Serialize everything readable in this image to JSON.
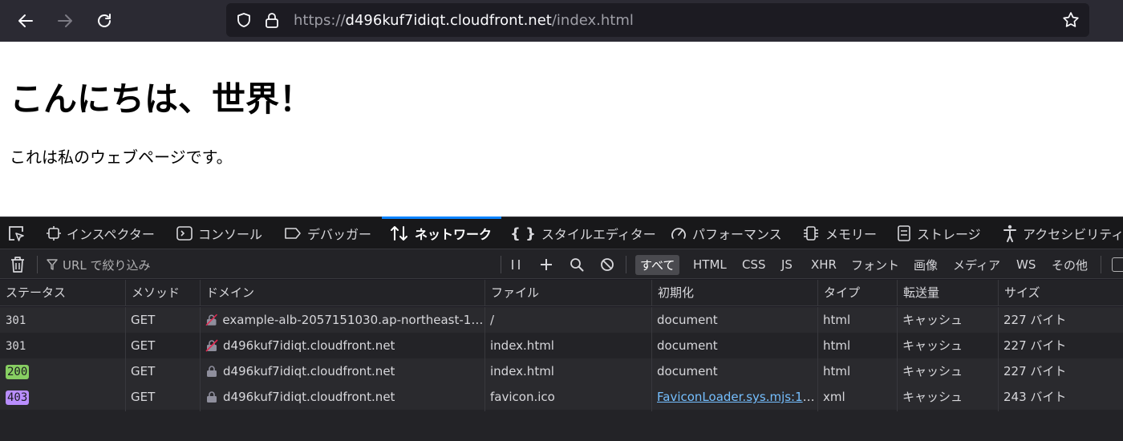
{
  "toolbar": {
    "url_prefix": "https://",
    "url_host": "d496kuf7idiqt.cloudfront.net",
    "url_path": "/index.html"
  },
  "page": {
    "heading": "こんにちは、世界！",
    "paragraph": "これは私のウェブページです。"
  },
  "devtools": {
    "tabs": [
      {
        "label": "インスペクター",
        "icon": "inspector-icon"
      },
      {
        "label": "コンソール",
        "icon": "console-icon"
      },
      {
        "label": "デバッガー",
        "icon": "debugger-icon"
      },
      {
        "label": "ネットワーク",
        "icon": "network-icon",
        "active": true
      },
      {
        "label": "スタイルエディター",
        "icon": "style-editor-icon"
      },
      {
        "label": "パフォーマンス",
        "icon": "performance-icon"
      },
      {
        "label": "メモリー",
        "icon": "memory-icon"
      },
      {
        "label": "ストレージ",
        "icon": "storage-icon"
      },
      {
        "label": "アクセシビリティ",
        "icon": "accessibility-icon"
      }
    ],
    "filter_placeholder": "URL で絞り込み",
    "filter_types": [
      "すべて",
      "HTML",
      "CSS",
      "JS",
      "XHR",
      "フォント",
      "画像",
      "メディア",
      "WS",
      "その他"
    ],
    "columns": [
      "ステータス",
      "メソッド",
      "ドメイン",
      "ファイル",
      "初期化",
      "タイプ",
      "転送量",
      "サイズ"
    ],
    "rows": [
      {
        "status": "301",
        "method": "GET",
        "domain": "example-alb-2057151030.ap-northeast-1.e…",
        "secure": false,
        "file": "/",
        "initiator": "document",
        "type": "html",
        "transferred": "キャッシュ",
        "size": "227 バイト"
      },
      {
        "status": "301",
        "method": "GET",
        "domain": "d496kuf7idiqt.cloudfront.net",
        "secure": false,
        "file": "index.html",
        "initiator": "document",
        "type": "html",
        "transferred": "キャッシュ",
        "size": "227 バイト"
      },
      {
        "status": "200",
        "method": "GET",
        "domain": "d496kuf7idiqt.cloudfront.net",
        "secure": true,
        "file": "index.html",
        "initiator": "document",
        "type": "html",
        "transferred": "キャッシュ",
        "size": "227 バイト"
      },
      {
        "status": "403",
        "method": "GET",
        "domain": "d496kuf7idiqt.cloudfront.net",
        "secure": true,
        "file": "favicon.ico",
        "initiator": "FaviconLoader.sys.mjs:17…",
        "type": "xml",
        "transferred": "キャッシュ",
        "size": "243 バイト"
      }
    ]
  },
  "colors": {
    "status_200": "#87ce62",
    "status_403": "#b98eff",
    "accent": "#0a84ff"
  }
}
